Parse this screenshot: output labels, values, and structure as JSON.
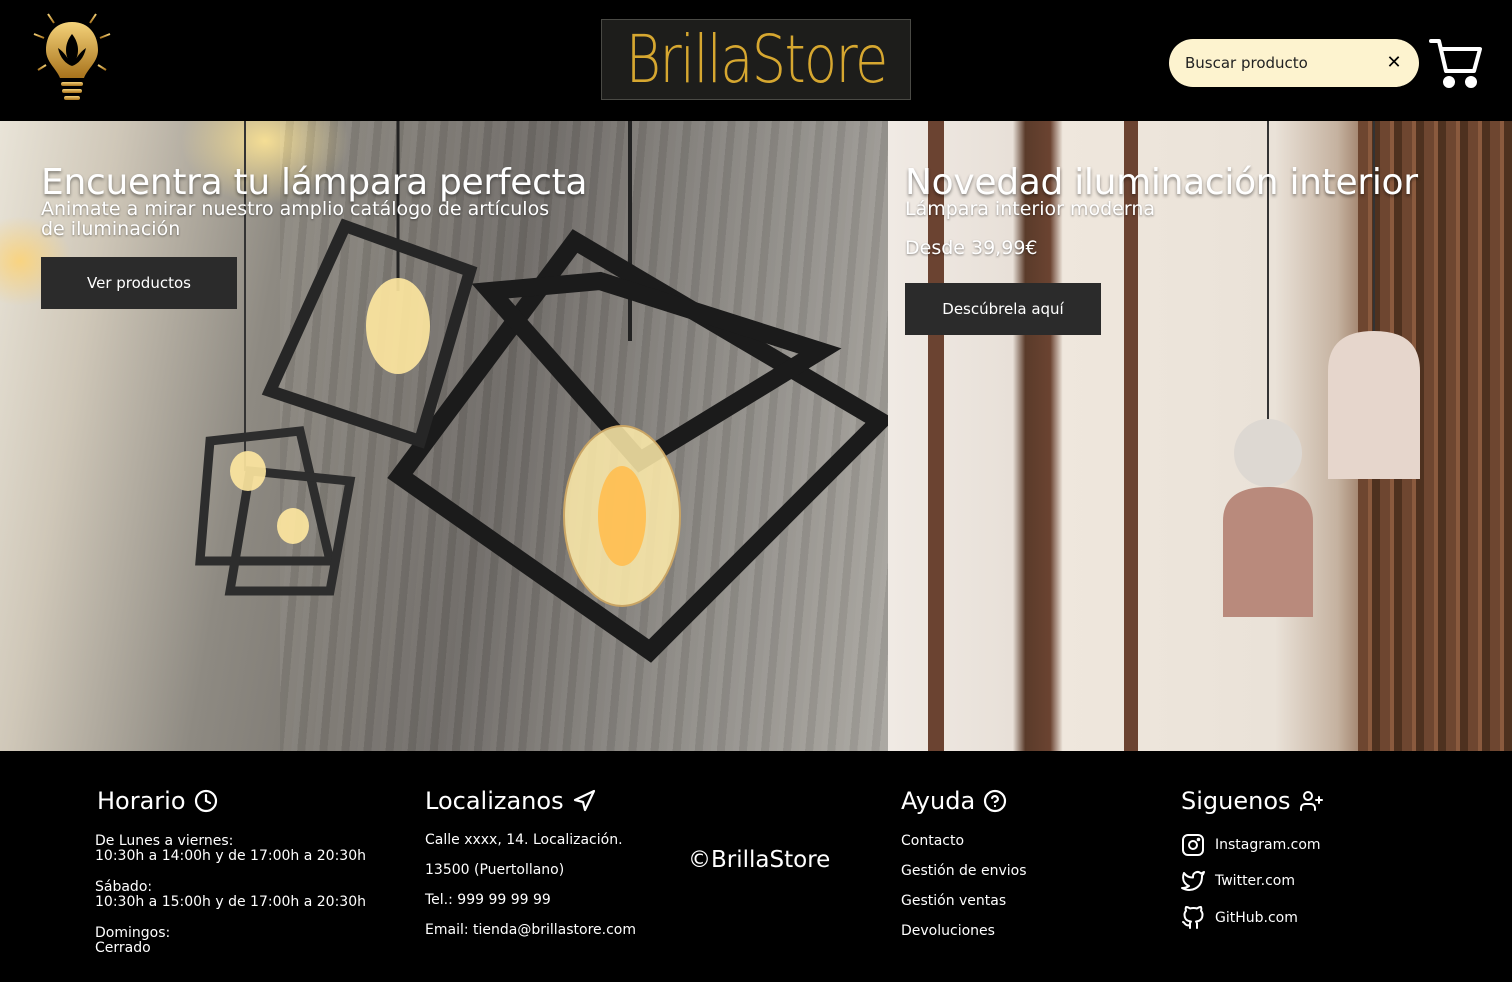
{
  "header": {
    "brand": "BrillaStore",
    "search_placeholder": "Buscar producto",
    "search_clear": "✕"
  },
  "hero": {
    "left": {
      "title": "Encuentra tu lámpara perfecta",
      "subtitle_line1": "Animate a mirar nuestro amplio catálogo de artículos",
      "subtitle_line2": "de iluminación",
      "button": "Ver productos"
    },
    "right": {
      "title": "Novedad iluminación interior",
      "subtitle": "Lámpara interior moderna",
      "price": "Desde 39,99€",
      "button": "Descúbrela aquí"
    }
  },
  "footer": {
    "schedule": {
      "title": "Horario",
      "lines": [
        [
          "De Lunes a viernes:",
          "10:30h a 14:00h y de 17:00h a 20:30h"
        ],
        [
          "Sábado:",
          "10:30h a 15:00h y de 17:00h a 20:30h"
        ],
        [
          "Domingos:",
          "Cerrado"
        ]
      ]
    },
    "location": {
      "title": "Localizanos",
      "lines": [
        "Calle xxxx, 14. Localización.",
        "13500 (Puertollano)",
        "Tel.: 999 99 99 99",
        "Email: tienda@brillastore.com"
      ]
    },
    "copyright": "©BrillaStore",
    "help": {
      "title": "Ayuda",
      "links": [
        "Contacto",
        "Gestión de envios",
        "Gestión ventas",
        "Devoluciones"
      ]
    },
    "social": {
      "title": "Siguenos",
      "links": [
        "Instagram.com",
        "Twitter.com",
        "GitHub.com"
      ]
    }
  },
  "colors": {
    "brand_gold": "#d6a730",
    "search_bg": "#fdf3cf",
    "button_bg": "#2b2b2b"
  },
  "icons": [
    "lightbulb-logo-icon",
    "close-icon",
    "cart-icon",
    "clock-icon",
    "navigation-arrow-icon",
    "help-circle-icon",
    "user-plus-icon",
    "instagram-icon",
    "twitter-icon",
    "github-icon"
  ]
}
